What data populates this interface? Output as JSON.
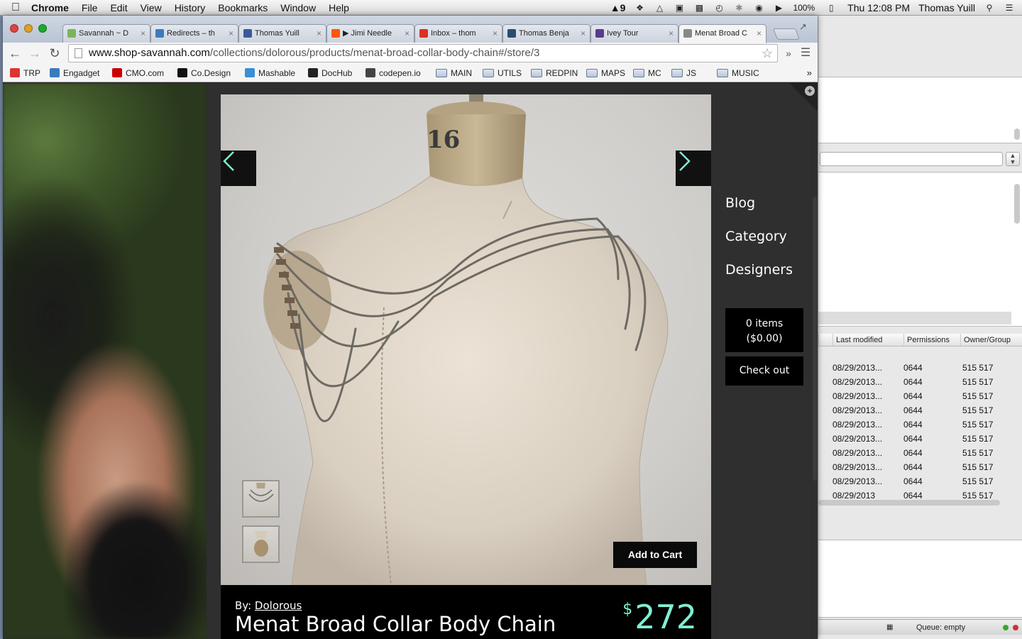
{
  "menubar": {
    "app_name": "Chrome",
    "items": [
      "File",
      "Edit",
      "View",
      "History",
      "Bookmarks",
      "Window",
      "Help"
    ],
    "adobe_count": "9",
    "battery": "100%",
    "clock": "Thu 12:08 PM",
    "user": "Thomas Yuill"
  },
  "tabs": [
    {
      "title": "Savannah ~ D",
      "icon": "shopify-icon",
      "color": "#7ab55c"
    },
    {
      "title": "Redirects – th",
      "icon": "hm-icon",
      "color": "#3a7bbf"
    },
    {
      "title": "Thomas Yuill",
      "icon": "facebook-icon",
      "color": "#3b5998"
    },
    {
      "title": "▶ Jimi Needle",
      "icon": "soundcloud-icon",
      "color": "#ff5500"
    },
    {
      "title": "Inbox – thom",
      "icon": "gmail-icon",
      "color": "#d93025"
    },
    {
      "title": "Thomas Benja",
      "icon": "app-icon",
      "color": "#2a4c6b"
    },
    {
      "title": "Ivey Tour",
      "icon": "shield-icon",
      "color": "#5a3b8c"
    },
    {
      "title": "Menat Broad C",
      "icon": "savannah-icon",
      "color": "#888888"
    }
  ],
  "address": {
    "domain": "www.shop-savannah.com",
    "path": "/collections/dolorous/products/menat-broad-collar-body-chain#/store/3"
  },
  "bookmarks": [
    {
      "label": "TRP",
      "type": "site",
      "color": "#d33"
    },
    {
      "label": "Engadget",
      "type": "site",
      "color": "#3a7bbf"
    },
    {
      "label": "CMO.com",
      "type": "site",
      "color": "#c00"
    },
    {
      "label": "Co.Design",
      "type": "site",
      "color": "#111"
    },
    {
      "label": "Mashable",
      "type": "site",
      "color": "#3a8fd6"
    },
    {
      "label": "DocHub",
      "type": "site",
      "color": "#222"
    },
    {
      "label": "codepen.io",
      "type": "site",
      "color": "#444"
    },
    {
      "label": "MAIN",
      "type": "folder"
    },
    {
      "label": "UTILS",
      "type": "folder"
    },
    {
      "label": "REDPIN",
      "type": "folder"
    },
    {
      "label": "MAPS",
      "type": "folder"
    },
    {
      "label": "MC",
      "type": "folder"
    },
    {
      "label": "JS",
      "type": "folder"
    },
    {
      "label": "MUSIC",
      "type": "folder"
    }
  ],
  "product": {
    "by_label": "By:",
    "designer": "Dolorous",
    "title": "Menat Broad Collar Body Chain",
    "currency": "$",
    "price": "272",
    "add_to_cart": "Add to Cart",
    "mannequin_number": "16"
  },
  "nav": {
    "links": [
      "Blog",
      "Category",
      "Designers"
    ],
    "cart_items": "0 items",
    "cart_total": "($0.00)",
    "checkout": "Check out"
  },
  "ftp": {
    "columns": [
      "Last modified",
      "Permissions",
      "Owner/Group"
    ],
    "rows": [
      {
        "modified": "08/29/2013...",
        "perm": "0644",
        "owner": "515 517"
      },
      {
        "modified": "08/29/2013...",
        "perm": "0644",
        "owner": "515 517"
      },
      {
        "modified": "08/29/2013...",
        "perm": "0644",
        "owner": "515 517"
      },
      {
        "modified": "08/29/2013...",
        "perm": "0644",
        "owner": "515 517"
      },
      {
        "modified": "08/29/2013...",
        "perm": "0644",
        "owner": "515 517"
      },
      {
        "modified": "08/29/2013...",
        "perm": "0644",
        "owner": "515 517"
      },
      {
        "modified": "08/29/2013...",
        "perm": "0644",
        "owner": "515 517"
      },
      {
        "modified": "08/29/2013...",
        "perm": "0644",
        "owner": "515 517"
      },
      {
        "modified": "08/29/2013...",
        "perm": "0644",
        "owner": "515 517"
      },
      {
        "modified": "08/29/2013",
        "perm": "0644",
        "owner": "515 517"
      }
    ],
    "status": "Queue: empty"
  },
  "colors": {
    "accent": "#7ff0d2",
    "modal_bg": "#2f2f2f",
    "button_bg": "#000000"
  }
}
